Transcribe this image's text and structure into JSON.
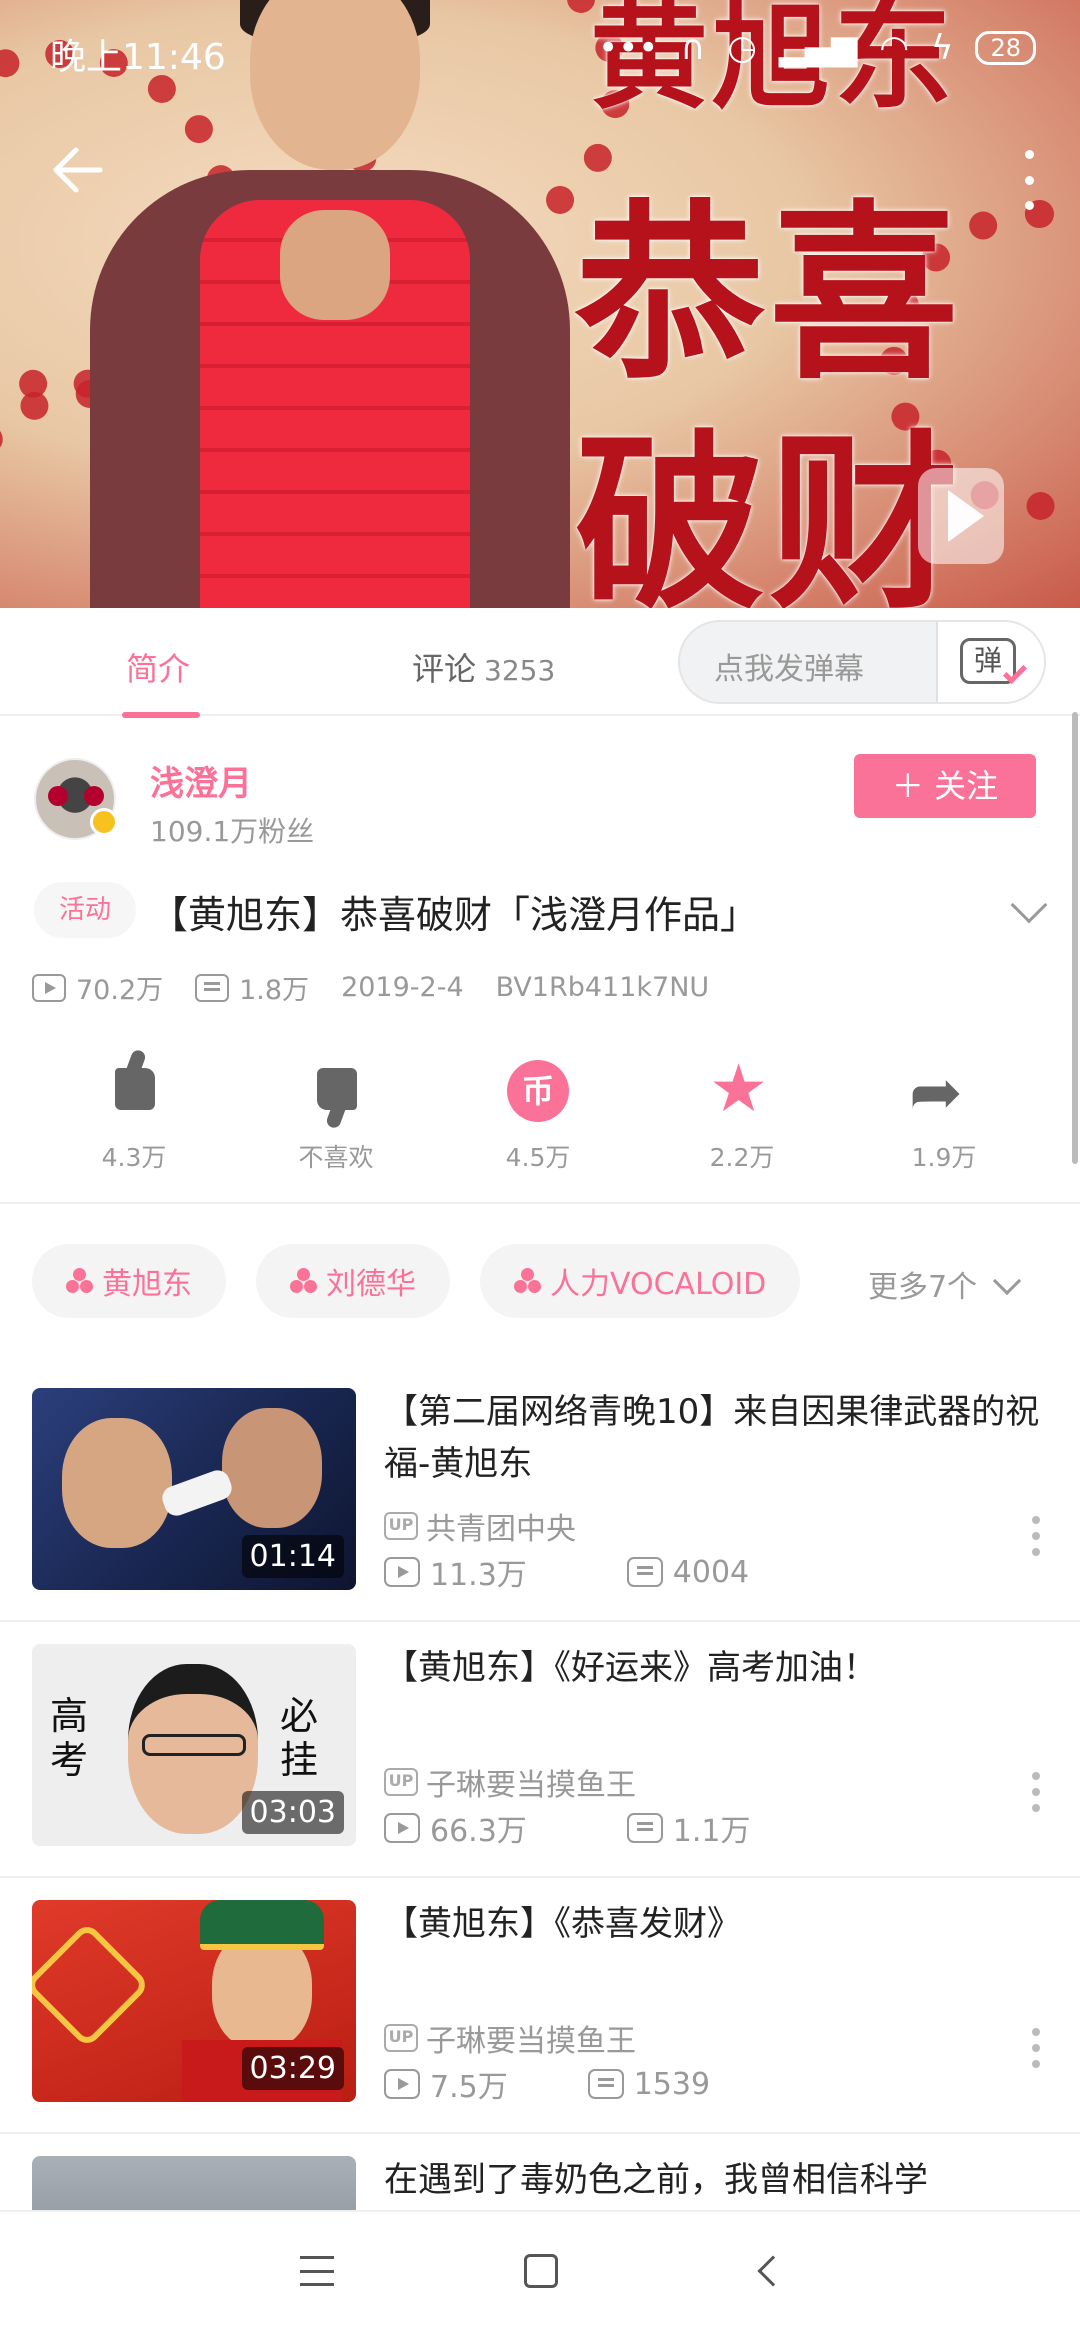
{
  "status_bar": {
    "time": "晚上11:46",
    "battery": "28",
    "icons": [
      "dots-icon",
      "headphone-icon",
      "alarm-icon",
      "hd-signal-icon",
      "wifi-icon",
      "charging-icon"
    ]
  },
  "video": {
    "overlay_name": "黄旭东",
    "overlay_line1": "恭喜",
    "overlay_line2": "破财"
  },
  "tabs": {
    "intro": "简介",
    "comments": "评论",
    "comments_count": "3253",
    "danmaku_placeholder": "点我发弹幕",
    "danmaku_icon_glyph": "弹"
  },
  "uploader": {
    "name": "浅澄月",
    "fans": "109.1万粉丝",
    "follow_label": "＋ 关注"
  },
  "video_info": {
    "activity_tag": "活动",
    "title": "【黄旭东】恭喜破财「浅澄月作品」",
    "views": "70.2万",
    "danmaku": "1.8万",
    "date": "2019-2-4",
    "bvid": "BV1Rb411k7NU"
  },
  "actions": {
    "like": "4.3万",
    "dislike": "不喜欢",
    "coin": "4.5万",
    "coin_glyph": "币",
    "favorite": "2.2万",
    "share": "1.9万"
  },
  "tags": [
    {
      "label": "黄旭东"
    },
    {
      "label": "刘德华"
    },
    {
      "label": "人力VOCALOID"
    }
  ],
  "more_tags": "更多7个",
  "related": [
    {
      "title": "【第二届网络青晚10】来自因果律武器的祝福-黄旭东",
      "duration": "01:14",
      "up": "共青团中央",
      "views": "11.3万",
      "danmaku": "4004"
    },
    {
      "title": "【黄旭东】《好运来》高考加油！",
      "duration": "03:03",
      "up": "子琳要当摸鱼王",
      "views": "66.3万",
      "danmaku": "1.1万",
      "thumb_left": "高考",
      "thumb_right": "必挂"
    },
    {
      "title": "【黄旭东】《恭喜发财》",
      "duration": "03:29",
      "up": "子琳要当摸鱼王",
      "views": "7.5万",
      "danmaku": "1539"
    },
    {
      "title": "在遇到了毒奶色之前，我曾相信科学"
    }
  ],
  "up_icon_label": "UP",
  "colors": {
    "accent": "#fb7299",
    "text": "#222222",
    "muted": "#999999"
  }
}
